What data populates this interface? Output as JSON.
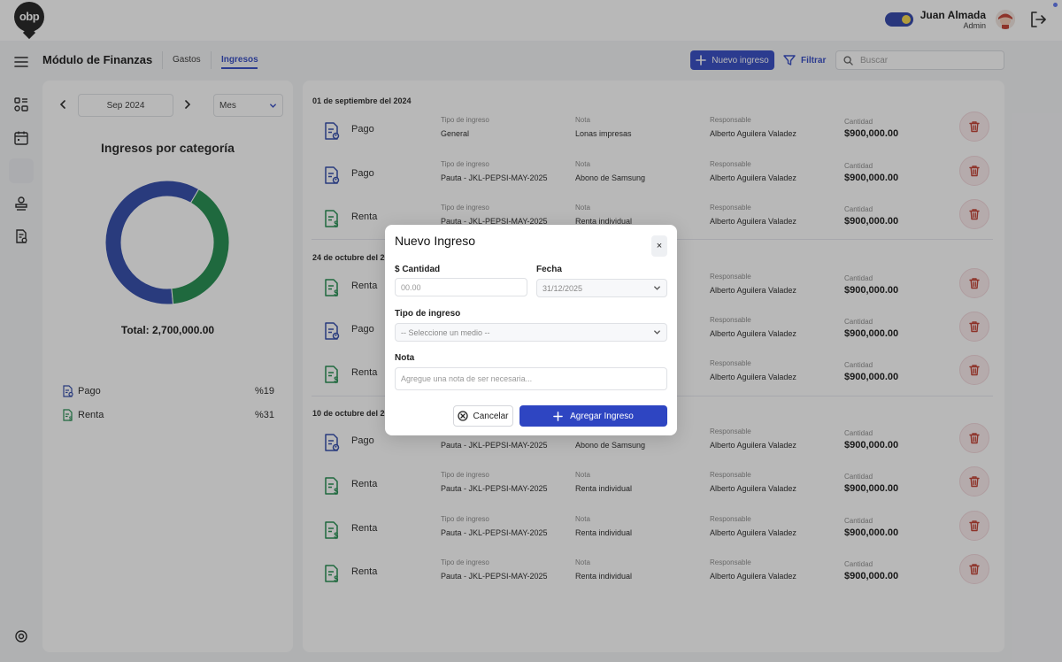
{
  "app": {
    "logo_text": "obp"
  },
  "user": {
    "name": "Juan Almada",
    "role": "Admin"
  },
  "header": {
    "title": "Módulo de Finanzas",
    "tabs": [
      {
        "label": "Gastos"
      },
      {
        "label": "Ingresos"
      }
    ],
    "new_button": "Nuevo ingreso",
    "filter_button": "Filtrar",
    "search_placeholder": "Buscar"
  },
  "left_panel": {
    "month": "Sep 2024",
    "period": "Mes",
    "chart_title": "Ingresos por categoría",
    "total": "Total: 2,700,000.00",
    "legend": [
      {
        "label": "Pago",
        "value": "%19"
      },
      {
        "label": "Renta",
        "value": "%31"
      }
    ]
  },
  "chart_data": {
    "type": "pie",
    "title": "Ingresos por categoría",
    "series": [
      {
        "name": "Pago",
        "value": 0.6,
        "color": "#2a45a8"
      },
      {
        "name": "Renta",
        "value": 0.4,
        "color": "#1b8a4a"
      }
    ],
    "legend_placement": "bottom"
  },
  "labels": {
    "tipo": "Tipo de ingreso",
    "nota": "Nota",
    "responsable": "Responsable",
    "cantidad": "Cantidad"
  },
  "groups": [
    {
      "date": "01 de septiembre del 2024",
      "rows": [
        {
          "name": "Pago",
          "icon": "payment-doc-icon",
          "tipo": "General",
          "nota": "Lonas impresas",
          "responsable": "Alberto Aguilera Valadez",
          "cantidad": "$900,000.00"
        },
        {
          "name": "Pago",
          "icon": "payment-doc-icon",
          "tipo": "Pauta - JKL-PEPSI-MAY-2025",
          "nota": "Abono de Samsung",
          "responsable": "Alberto Aguilera Valadez",
          "cantidad": "$900,000.00"
        },
        {
          "name": "Renta",
          "icon": "rent-doc-icon",
          "tipo": "Pauta - JKL-PEPSI-MAY-2025",
          "nota": "Renta individual",
          "responsable": "Alberto Aguilera Valadez",
          "cantidad": "$900,000.00"
        }
      ]
    },
    {
      "date": "24 de octubre del 2024",
      "rows": [
        {
          "name": "Renta",
          "icon": "rent-doc-icon",
          "tipo": "",
          "nota": "",
          "responsable": "Alberto Aguilera Valadez",
          "cantidad": "$900,000.00"
        },
        {
          "name": "Pago",
          "icon": "payment-doc-icon",
          "tipo": "",
          "nota": "",
          "responsable": "Alberto Aguilera Valadez",
          "cantidad": "$900,000.00"
        },
        {
          "name": "Renta",
          "icon": "rent-doc-icon",
          "tipo": "",
          "nota": "",
          "responsable": "Alberto Aguilera Valadez",
          "cantidad": "$900,000.00"
        }
      ]
    },
    {
      "date": "10 de octubre del 2024",
      "rows": [
        {
          "name": "Pago",
          "icon": "payment-doc-icon",
          "tipo": "Pauta - JKL-PEPSI-MAY-2025",
          "nota": "Abono de Samsung",
          "responsable": "Alberto Aguilera Valadez",
          "cantidad": "$900,000.00",
          "labels_hidden": true
        },
        {
          "name": "Renta",
          "icon": "rent-doc-icon",
          "tipo": "Pauta - JKL-PEPSI-MAY-2025",
          "nota": "Renta individual",
          "responsable": "Alberto Aguilera Valadez",
          "cantidad": "$900,000.00"
        },
        {
          "name": "Renta",
          "icon": "rent-doc-icon",
          "tipo": "Pauta - JKL-PEPSI-MAY-2025",
          "nota": "Renta individual",
          "responsable": "Alberto Aguilera Valadez",
          "cantidad": "$900,000.00"
        },
        {
          "name": "Renta",
          "icon": "rent-doc-icon",
          "tipo": "Pauta - JKL-PEPSI-MAY-2025",
          "nota": "Renta individual",
          "responsable": "Alberto Aguilera Valadez",
          "cantidad": "$900,000.00"
        }
      ]
    }
  ],
  "modal": {
    "title": "Nuevo Ingreso",
    "close_label": "×",
    "cantidad_label": "$ Cantidad",
    "cantidad_placeholder": "00.00",
    "fecha_label": "Fecha",
    "fecha_value": "31/12/2025",
    "tipo_label": "Tipo de ingreso",
    "tipo_placeholder": "-- Seleccione un medio --",
    "nota_label": "Nota",
    "nota_placeholder": "Agregue una nota de ser necesaria...",
    "cancel_label": "Cancelar",
    "add_label": "Agregar Ingreso"
  },
  "colors": {
    "primary": "#2e45c2",
    "pago": "#2a45a8",
    "renta": "#1b8a4a",
    "danger": "#c0392b"
  }
}
